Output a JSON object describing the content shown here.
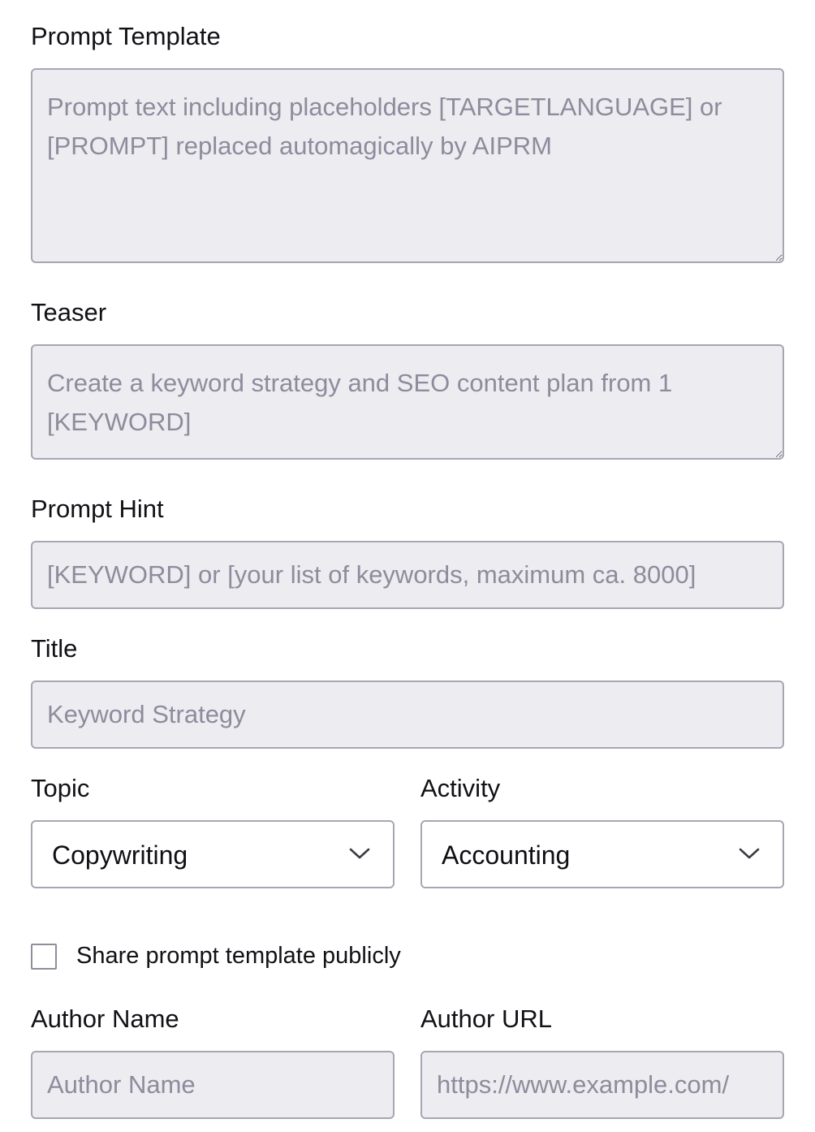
{
  "prompt_template": {
    "label": "Prompt Template",
    "placeholder": "Prompt text including placeholders [TARGETLANGUAGE] or [PROMPT] replaced automagically by AIPRM"
  },
  "teaser": {
    "label": "Teaser",
    "placeholder": "Create a keyword strategy and SEO content plan from 1 [KEYWORD]"
  },
  "prompt_hint": {
    "label": "Prompt Hint",
    "placeholder": "[KEYWORD] or [your list of keywords, maximum ca. 8000]"
  },
  "title": {
    "label": "Title",
    "placeholder": "Keyword Strategy"
  },
  "topic": {
    "label": "Topic",
    "selected": "Copywriting",
    "icon": "chevron-down-icon"
  },
  "activity": {
    "label": "Activity",
    "selected": "Accounting",
    "icon": "chevron-down-icon"
  },
  "share": {
    "label": "Share prompt template publicly",
    "checked": false
  },
  "author_name": {
    "label": "Author Name",
    "placeholder": "Author Name"
  },
  "author_url": {
    "label": "Author URL",
    "placeholder": "https://www.example.com/"
  },
  "colors": {
    "field_background": "#ececf1",
    "field_border": "#a7a6b3",
    "placeholder_text": "#8e8c9c",
    "label_text": "#111116"
  }
}
